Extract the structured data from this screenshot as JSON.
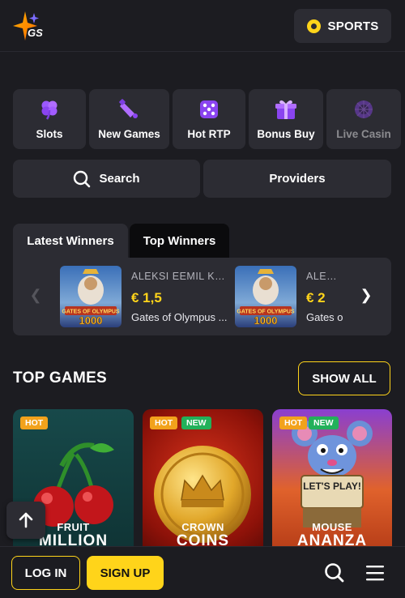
{
  "header": {
    "logo_text": "GS",
    "sports_label": "SPORTS"
  },
  "categories": [
    {
      "label": "Slots",
      "icon": "clover-icon"
    },
    {
      "label": "New Games",
      "icon": "bell-icon"
    },
    {
      "label": "Hot RTP",
      "icon": "dice-icon"
    },
    {
      "label": "Bonus Buy",
      "icon": "gift-icon"
    },
    {
      "label": "Live Casin",
      "icon": "roulette-icon"
    }
  ],
  "actions": {
    "search_label": "Search",
    "providers_label": "Providers"
  },
  "winners": {
    "tabs": [
      "Latest Winners",
      "Top Winners"
    ],
    "active_tab": "Top Winners",
    "items": [
      {
        "name": "ALEKSI EEMIL KRI...",
        "amount": "€ 1,5",
        "game": "Gates of Olympus ...",
        "thumb_label": "GATES OF OLYMPUS",
        "thumb_number": "1000"
      },
      {
        "name": "ALEKSI",
        "amount": "€ 2",
        "game": "Gates o",
        "thumb_label": "GATES OF OLYMPUS",
        "thumb_number": "1000"
      }
    ]
  },
  "top_games": {
    "title": "TOP GAMES",
    "show_all_label": "SHOW ALL",
    "games": [
      {
        "badges": [
          "HOT"
        ],
        "line1": "FRUIT",
        "line2": "MILLION"
      },
      {
        "badges": [
          "HOT",
          "NEW"
        ],
        "line1": "CROWN",
        "line2": "COINS"
      },
      {
        "badges": [
          "HOT",
          "NEW"
        ],
        "line1": "MOUSE",
        "line2": "ANANZA",
        "sign": "LET'S PLAY!"
      }
    ]
  },
  "bottom_bar": {
    "login_label": "LOG IN",
    "signup_label": "SIGN UP"
  },
  "colors": {
    "accent": "#ffd41a",
    "background": "#1c1c21",
    "tile": "#2c2c33",
    "hot": "#f2a21c",
    "new": "#22b15a"
  }
}
